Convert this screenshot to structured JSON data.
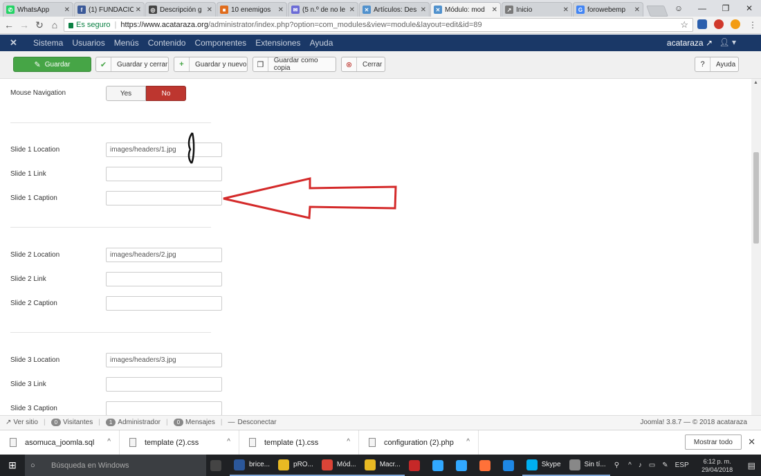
{
  "browser": {
    "tabs": [
      {
        "title": "WhatsApp",
        "favicon": "whatsapp-icon",
        "color": "#25d366",
        "glyph": "✆"
      },
      {
        "title": "(1) FUNDACIÓ",
        "favicon": "facebook-icon",
        "color": "#3b5998",
        "glyph": "f"
      },
      {
        "title": "Descripción g",
        "favicon": "generic-site-icon",
        "color": "#444444",
        "glyph": "◎"
      },
      {
        "title": "10 enemigos",
        "favicon": "generic-site-icon",
        "color": "#e06c1c",
        "glyph": "■"
      },
      {
        "title": "(5 n.º de no le",
        "favicon": "mail-icon",
        "color": "#6b6bd6",
        "glyph": "✉"
      },
      {
        "title": "Artículos: Des",
        "favicon": "joomla-icon",
        "color": "#5091cd",
        "glyph": "✕"
      },
      {
        "title": "Módulo: mod",
        "favicon": "joomla-icon",
        "color": "#5091cd",
        "glyph": "✕",
        "active": true
      },
      {
        "title": "Inicio",
        "favicon": "generic-site-icon",
        "color": "#7a7a7a",
        "glyph": "↗"
      },
      {
        "title": "forowebemp",
        "favicon": "google-icon",
        "color": "#4285f4",
        "glyph": "G"
      }
    ],
    "secure_label": "Es seguro",
    "url_host": "https://www.acataraza.org",
    "url_path": "/administrator/index.php?option=com_modules&view=module&layout=edit&id=89"
  },
  "joomla_nav": {
    "menu": [
      "Sistema",
      "Usuarios",
      "Menús",
      "Contenido",
      "Componentes",
      "Extensiones",
      "Ayuda"
    ],
    "site_name": "acataraza"
  },
  "toolbar": {
    "save": "Guardar",
    "save_close": "Guardar y cerrar",
    "save_new": "Guardar y nuevo",
    "save_copy": "Guardar como copia",
    "close": "Cerrar",
    "help": "Ayuda"
  },
  "form": {
    "mouse_nav_label": "Mouse Navigation",
    "toggle_yes": "Yes",
    "toggle_no": "No",
    "toggle_value": "No",
    "slides": [
      {
        "location_label": "Slide 1 Location",
        "location_value": "images/headers/1.jpg",
        "link_label": "Slide 1 Link",
        "link_value": "",
        "caption_label": "Slide 1 Caption",
        "caption_value": ""
      },
      {
        "location_label": "Slide 2 Location",
        "location_value": "images/headers/2.jpg",
        "link_label": "Slide 2 Link",
        "link_value": "",
        "caption_label": "Slide 2 Caption",
        "caption_value": ""
      },
      {
        "location_label": "Slide 3 Location",
        "location_value": "images/headers/3.jpg",
        "link_label": "Slide 3 Link",
        "link_value": "",
        "caption_label": "Slide 3 Caption",
        "caption_value": ""
      }
    ]
  },
  "status": {
    "view_site": "Ver sitio",
    "visitors_count": "0",
    "visitors_label": "Visitantes",
    "admin_count": "1",
    "admin_label": "Administrador",
    "messages_count": "0",
    "messages_label": "Mensajes",
    "logout": "Desconectar",
    "footer": "Joomla! 3.8.7 — © 2018 acataraza"
  },
  "downloads": {
    "files": [
      "asomuca_joomla.sql",
      "template (2).css",
      "template (1).css",
      "configuration (2).php"
    ],
    "show_all": "Mostrar todo"
  },
  "taskbar": {
    "search_placeholder": "Búsqueda en Windows",
    "apps": [
      {
        "label": "",
        "color": "#444444"
      },
      {
        "label": "brice...",
        "color": "#2b579a"
      },
      {
        "label": "pRO...",
        "color": "#e8b923"
      },
      {
        "label": "Mód...",
        "color": "#db4437"
      },
      {
        "label": "Macr...",
        "color": "#e8b923"
      },
      {
        "label": "",
        "color": "#c62828"
      },
      {
        "label": "",
        "color": "#31a8ff"
      },
      {
        "label": "",
        "color": "#31a8ff"
      },
      {
        "label": "",
        "color": "#ff7139"
      },
      {
        "label": "",
        "color": "#1e88e5"
      },
      {
        "label": "Skype",
        "color": "#00aff0"
      },
      {
        "label": "Sin tí...",
        "color": "#888888"
      }
    ],
    "lang": "ESP",
    "time": "6:12 p. m.",
    "date": "29/04/2018"
  }
}
